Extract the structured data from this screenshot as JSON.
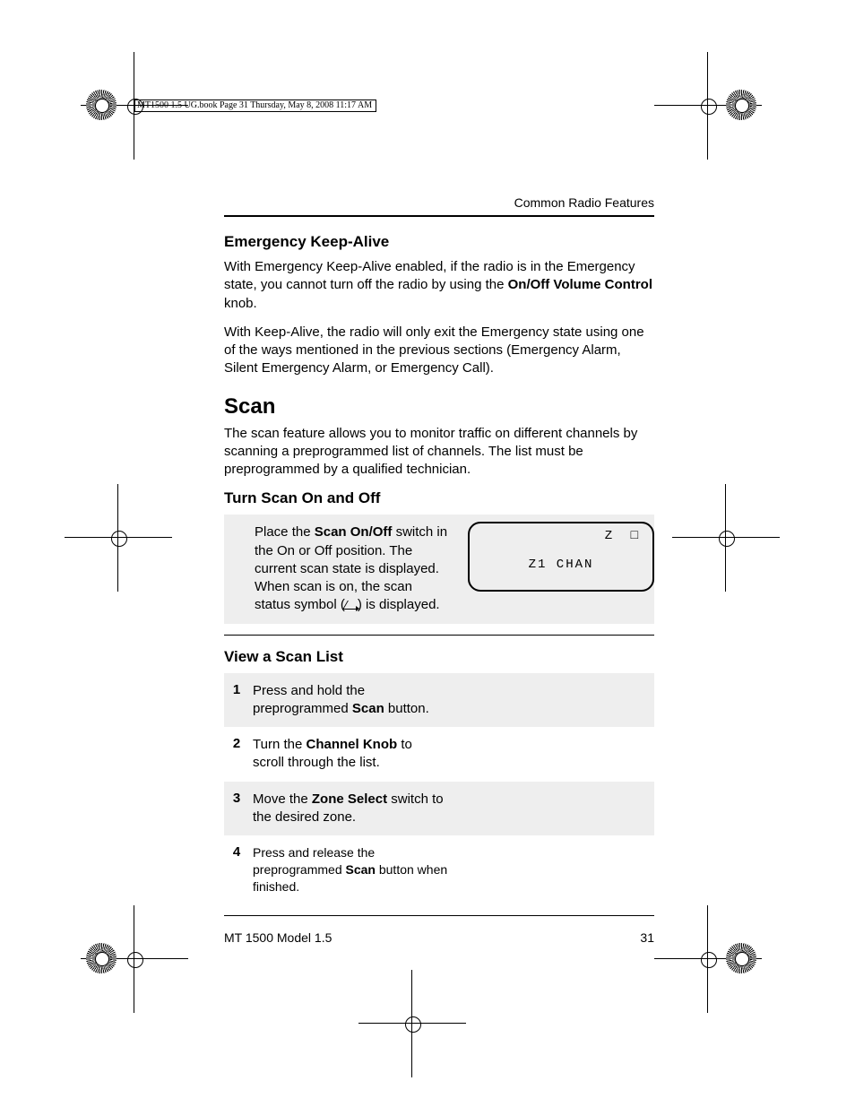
{
  "meta_line": "MT1500 1.5 UG.book  Page 31  Thursday, May 8, 2008  11:17 AM",
  "running_head": "Common Radio Features",
  "s1": {
    "title": "Emergency Keep-Alive",
    "p1a": "With Emergency Keep-Alive enabled, if the radio is in the Emergency state, you cannot turn off the radio by using the ",
    "p1b": "On/Off Volume Control",
    "p1c": " knob.",
    "p2": "With Keep-Alive, the radio will only exit the Emergency state using one of the ways mentioned in the previous sections (Emergency Alarm, Silent Emergency Alarm, or Emergency Call)."
  },
  "s2": {
    "title": "Scan",
    "intro": "The scan feature allows you to monitor traffic on different channels by scanning a preprogrammed list of channels. The list must be preprogrammed by a qualified technician."
  },
  "s3": {
    "title": "Turn Scan On and Off",
    "t1": "Place the ",
    "t1b": "Scan On/Off",
    "t2": " switch in the On or Off position. The current scan state is displayed. When scan is on, the scan status symbol (",
    "t3": ") is displayed.",
    "lcd_icons": "Z  □",
    "lcd_line": "Z1 CHAN"
  },
  "s4": {
    "title": "View a Scan List",
    "steps": [
      {
        "n": "1",
        "a": "Press and hold the preprogrammed ",
        "b": "Scan",
        "c": " button."
      },
      {
        "n": "2",
        "a": "Turn the ",
        "b": "Channel Knob",
        "c": " to scroll through the list."
      },
      {
        "n": "3",
        "a": "Move the ",
        "b": "Zone Select",
        "c": " switch to the desired zone."
      },
      {
        "n": "4",
        "a": "Press and release the preprogrammed ",
        "b": "Scan",
        "c": " button when finished."
      }
    ]
  },
  "footer": {
    "left": "MT 1500 Model 1.5",
    "right": "31"
  }
}
